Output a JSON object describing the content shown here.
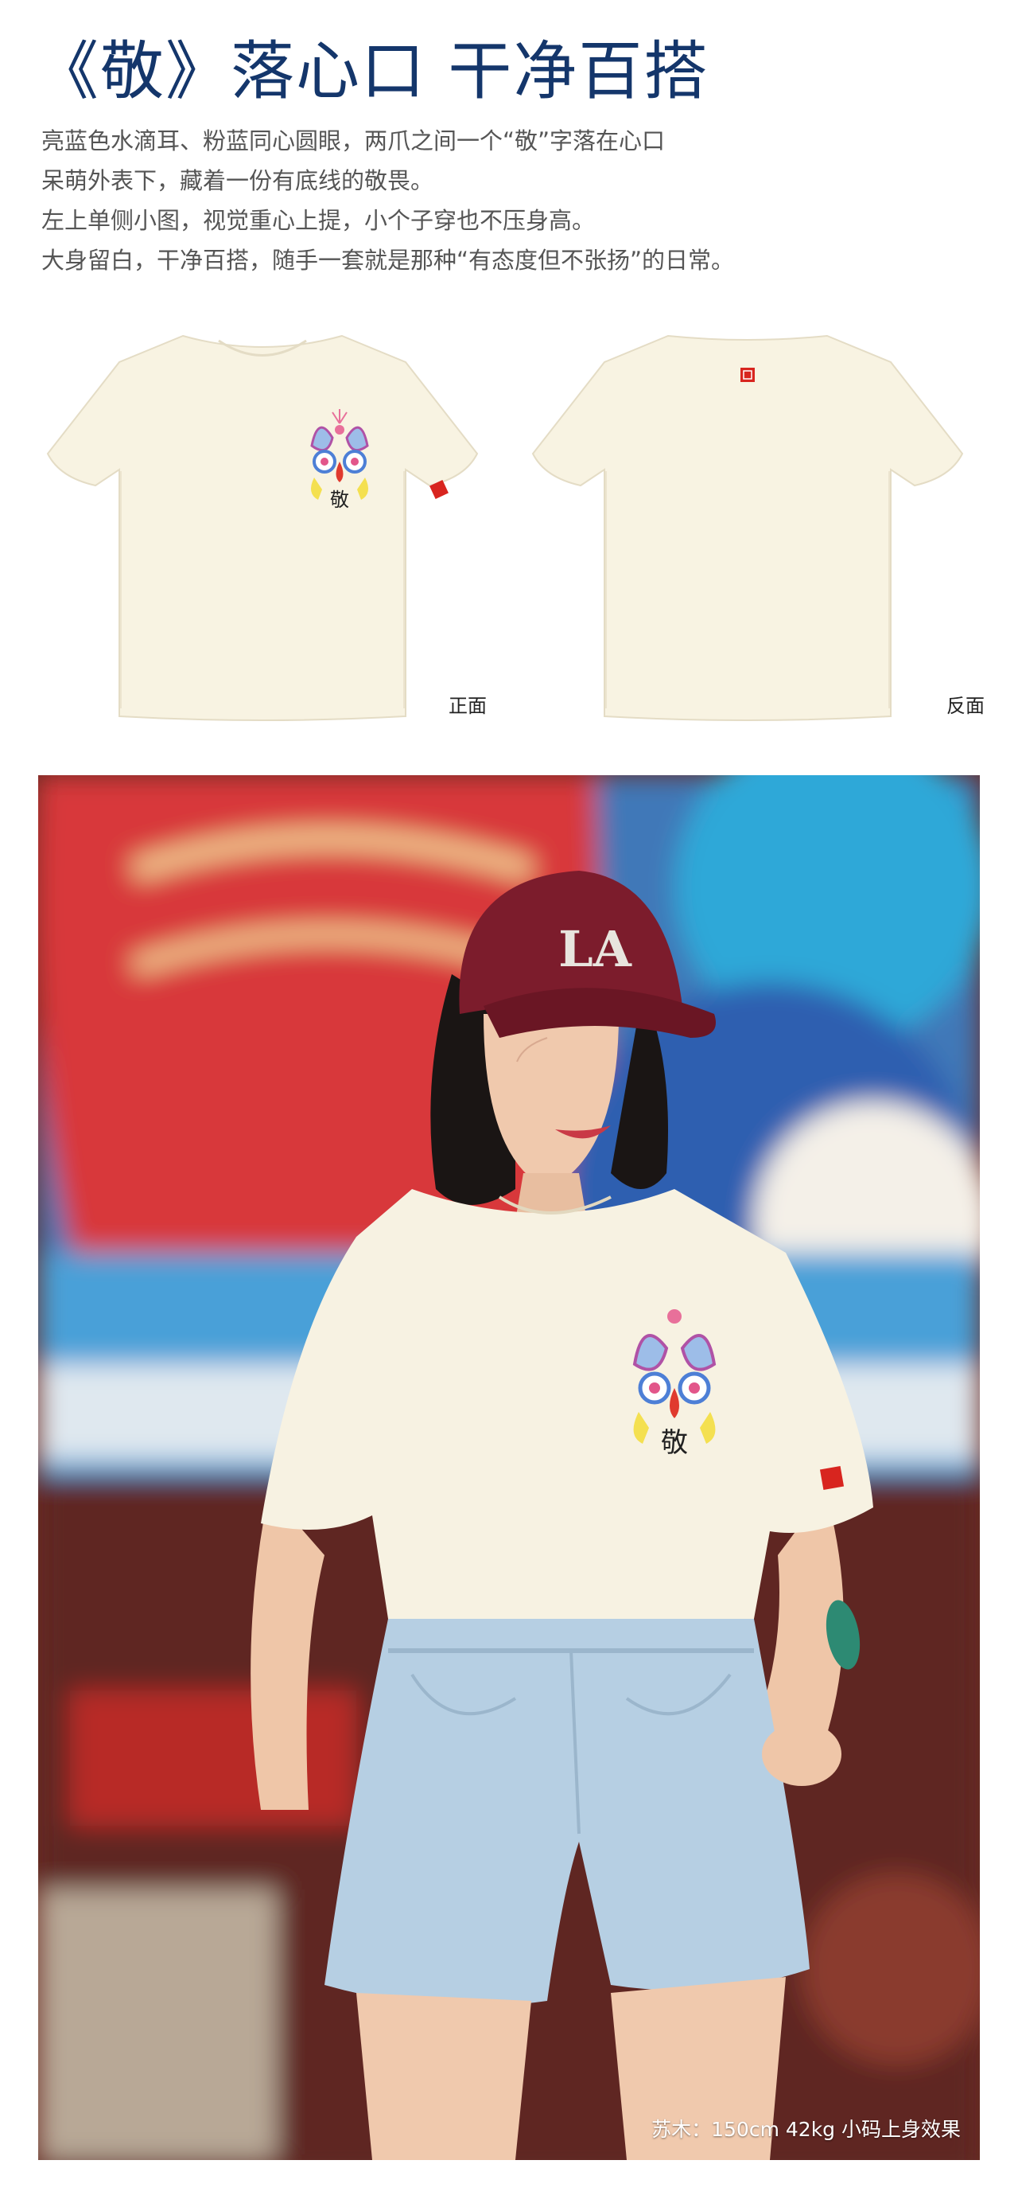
{
  "header": {
    "title": "《敬》落心口 干净百搭",
    "lines": [
      "亮蓝色水滴耳、粉蓝同心圆眼，两爪之间一个“敬”字落在心口",
      "呆萌外表下，藏着一份有底线的敬畏。",
      "左上单侧小图，视觉重心上提，小个子穿也不压身高。",
      "大身留白，干净百搭，随手一套就是那种“有态度但不张扬”的日常。"
    ]
  },
  "views": {
    "front_label": "正面",
    "back_label": "反面"
  },
  "shirt": {
    "fabric_color": "#f8f3e2",
    "tag_color": "#d8251f",
    "print_character": "敬"
  },
  "model_photo": {
    "cap_logo": "LA",
    "cap_color": "#7c1c2c",
    "caption": "苏木：150cm 42kg  小码上身效果"
  }
}
